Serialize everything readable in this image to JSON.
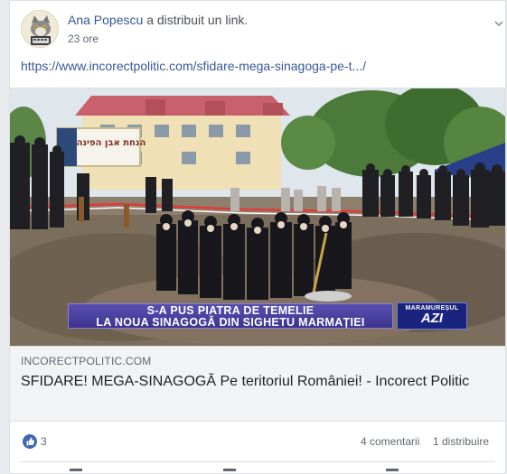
{
  "post": {
    "author": "Ana Popescu",
    "action": "a distribuit un link.",
    "timestamp": "23 ore",
    "link_url_text": "https://www.incorectpolitic.com/sfidare-mega-sinagoga-pe-t.../",
    "options_icon": "chevron-down-icon"
  },
  "media": {
    "banner_line1": "S-A PUS PIATRA DE TEMELIE",
    "banner_line2": "LA NOUA SINAGOGĂ DIN SIGHETU MARMAȚIEI",
    "brand_top": "MARAMUREȘUL",
    "brand_main": "AZI",
    "hebrew_sign": "הנחת אבן הפינה"
  },
  "link_preview": {
    "domain": "INCORECTPOLITIC.COM",
    "title": "SFIDARE! MEGA-SINAGOGĂ Pe teritoriul României! - Incorect Politic"
  },
  "stats": {
    "likes": "3",
    "comments": "4 comentarii",
    "shares": "1 distribuire"
  },
  "colors": {
    "link_blue": "#365899",
    "like_blue": "#4267b2",
    "banner_purple": "#4a3fa0"
  }
}
